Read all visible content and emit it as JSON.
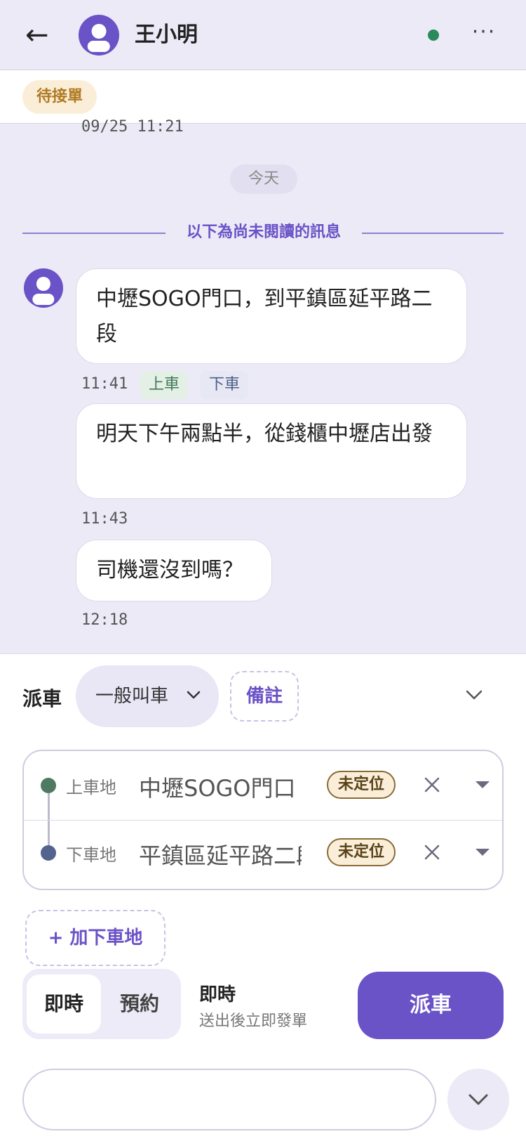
{
  "header": {
    "back_icon": "←",
    "contact_name": "王小明",
    "more_icon": "···",
    "online_color": "#2a8a5a"
  },
  "status": {
    "badge": "待接單"
  },
  "messages": {
    "prev_time": "09/25 11:21",
    "date_chip": "今天",
    "unread_divider": "以下為尚未閱讀的訊息",
    "items": [
      {
        "text": "中壢SOGO門口，到平鎮區延平路二段",
        "time": "11:41",
        "tag_pickup": "上車",
        "tag_dropoff": "下車"
      },
      {
        "text": "明天下午兩點半，從錢櫃中壢店出發",
        "time": "11:43"
      },
      {
        "text": "司機還沒到嗎？",
        "time": "12:18"
      }
    ]
  },
  "dispatch": {
    "label": "派車",
    "type_value": "一般叫車",
    "note_label": "備註",
    "pickup_label": "上車地",
    "pickup_value": "中壢SOGO門口",
    "dropoff_label": "下車地",
    "dropoff_value": "平鎮區延平路二段",
    "unlocated": "未定位",
    "add_dropoff": "+ 加下車地",
    "mode_now": "即時",
    "mode_book": "預約",
    "mode_title": "即時",
    "mode_desc": "送出後立即發單",
    "submit": "派車"
  },
  "input": {
    "value": ""
  },
  "colors": {
    "accent": "#6a52c7",
    "background": "#ebeaf6",
    "pickup": "#4e7a63",
    "dropoff": "#53628e"
  }
}
